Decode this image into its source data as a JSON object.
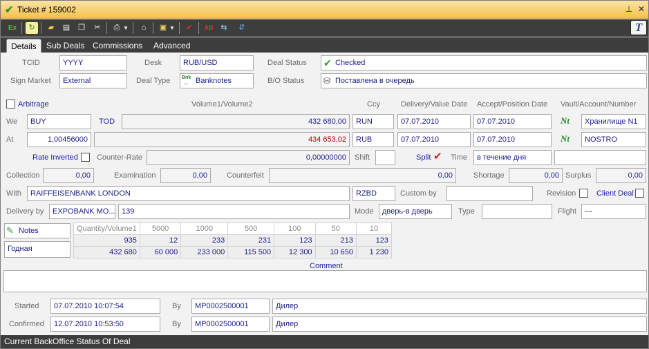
{
  "window": {
    "title": "Ticket # 159002",
    "pin_icon": "pin-icon",
    "close_icon": "close-icon"
  },
  "toolbar": {
    "items": [
      "execute-icon",
      "refresh-icon",
      "open-folder-icon",
      "document-icon",
      "copy-document-icon",
      "tools-icon",
      "print-icon",
      "dropdown-icon",
      "send-icon",
      "inbox-icon",
      "dropdown-icon",
      "confirm-icon",
      "abort-icon",
      "split-icon",
      "link-icon"
    ],
    "first_label": "Ex",
    "logo": "T"
  },
  "tabs": [
    "Details",
    "Sub Deals",
    "Commissions",
    "Advanced"
  ],
  "details": {
    "tcid_label": "TCID",
    "tcid": "YYYY",
    "desk_label": "Desk",
    "desk": "RUB/USD",
    "deal_status_label": "Deal Status",
    "deal_status": "Checked",
    "sign_market_label": "Sign Market",
    "sign_market": "External",
    "deal_type_label": "Deal Type",
    "deal_type_icon_text": "Bnk",
    "deal_type": "Banknotes",
    "bo_status_label": "B/O Status",
    "bo_status": "Поставлена в очередь",
    "arbitrage": "Arbitrage",
    "col_volume": "Volume1/Volume2",
    "col_ccy": "Ccy",
    "col_delivery": "Delivery/Value Date",
    "col_accept": "Accept/Position Date",
    "col_vault": "Vault/Account/Number",
    "we_label": "We",
    "we_side": "BUY",
    "we_term": "TOD",
    "we_volume": "432 680,00",
    "we_ccy": "RUN",
    "we_delivery": "07.07.2010",
    "we_accept": "07.07.2010",
    "we_nt": "Nt",
    "we_vault": "Хранилище N1",
    "at_label": "At",
    "at_rate": "1,00456000",
    "at_volume": "434 653,02",
    "at_ccy": "RUB",
    "at_delivery": "07.07.2010",
    "at_accept": "07.07.2010",
    "at_nt": "Nt",
    "at_vault": "NOSTRO",
    "rate_inverted": "Rate Inverted",
    "counter_rate_label": "Counter-Rate",
    "counter_rate": "0,00000000",
    "shift_label": "Shift",
    "split_label": "Split",
    "time_label": "Time",
    "time_value": "в течение дня",
    "collection_label": "Collection",
    "collection": "0,00",
    "examination_label": "Examination",
    "examination": "0,00",
    "counterfeit_label": "Counterfeit",
    "counterfeit": "0,00",
    "shortage_label": "Shortage",
    "shortage": "0,00",
    "surplus_label": "Surplus",
    "surplus": "0,00",
    "with_label": "With",
    "with_value": "RAIFFEISENBANK LONDON",
    "with_code": "RZBD",
    "custom_by_label": "Custom by",
    "revision_label": "Revision",
    "client_deal_label": "Client Deal",
    "delivery_by_label": "Delivery by",
    "delivery_by": "EXPOBANK MO...",
    "delivery_no": "139",
    "mode_label": "Mode",
    "mode_value": "дверь-в дверь",
    "type_label": "Type",
    "flight_label": "Flight",
    "flight_value": "---",
    "notes_label": "Notes",
    "quality": "Годная",
    "grid_headers": [
      "Quantity/Volume1",
      "5000",
      "1000",
      "500",
      "100",
      "50",
      "10"
    ],
    "grid_row1": [
      "935",
      "12",
      "233",
      "231",
      "123",
      "213",
      "123"
    ],
    "grid_row2": [
      "432 680",
      "60 000",
      "233 000",
      "115 500",
      "12 300",
      "10 650",
      "1 230"
    ],
    "comment_label": "Comment",
    "started_label": "Started",
    "started": "07.07.2010 10:07:54",
    "started_by_label": "By",
    "started_by": "MP0002500001",
    "started_role": "Дилер",
    "confirmed_label": "Confirmed",
    "confirmed": "12.07.2010 10:53:50",
    "confirmed_by_label": "By",
    "confirmed_by": "MP0002500001",
    "confirmed_role": "Дилер"
  },
  "status_bar": "Current BackOffice Status Of Deal"
}
